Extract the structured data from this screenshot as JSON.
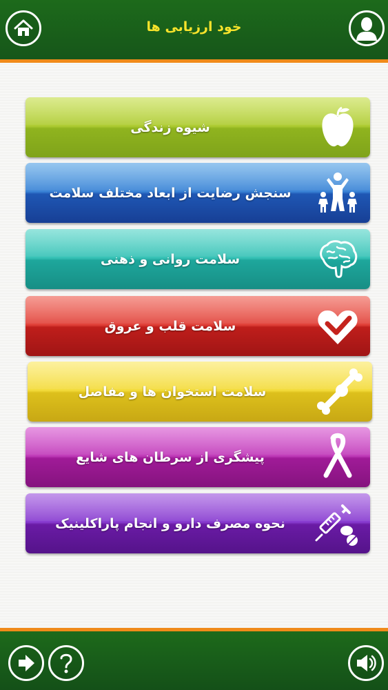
{
  "header": {
    "title": "خود ارزیابی ها"
  },
  "menu": {
    "items": [
      {
        "label": "شیوه زندگی",
        "icon": "apple-icon",
        "color": "#9fc02c"
      },
      {
        "label": "سنجش رضایت از ابعاد مختلف سلامت",
        "icon": "family-icon",
        "color": "#2a63b8"
      },
      {
        "label": "سلامت روانی و ذهنی",
        "icon": "brain-icon",
        "color": "#22b5ac"
      },
      {
        "label": "سلامت قلب و عروق",
        "icon": "heart-check-icon",
        "color": "#c5231d"
      },
      {
        "label": "سلامت استخوان ها و مفاصل",
        "icon": "bone-joint-icon",
        "color": "#e4c81d"
      },
      {
        "label": "پیشگری از سرطان های شایع",
        "icon": "ribbon-icon",
        "color": "#a01b98"
      },
      {
        "label": "نحوه مصرف دارو و انجام پاراکلینیک",
        "icon": "syringe-pills-icon",
        "color": "#6a1ba5"
      }
    ]
  },
  "colors": {
    "bar": "#1d6a1b",
    "accent": "#f08a1a",
    "title": "#f7e32b"
  }
}
